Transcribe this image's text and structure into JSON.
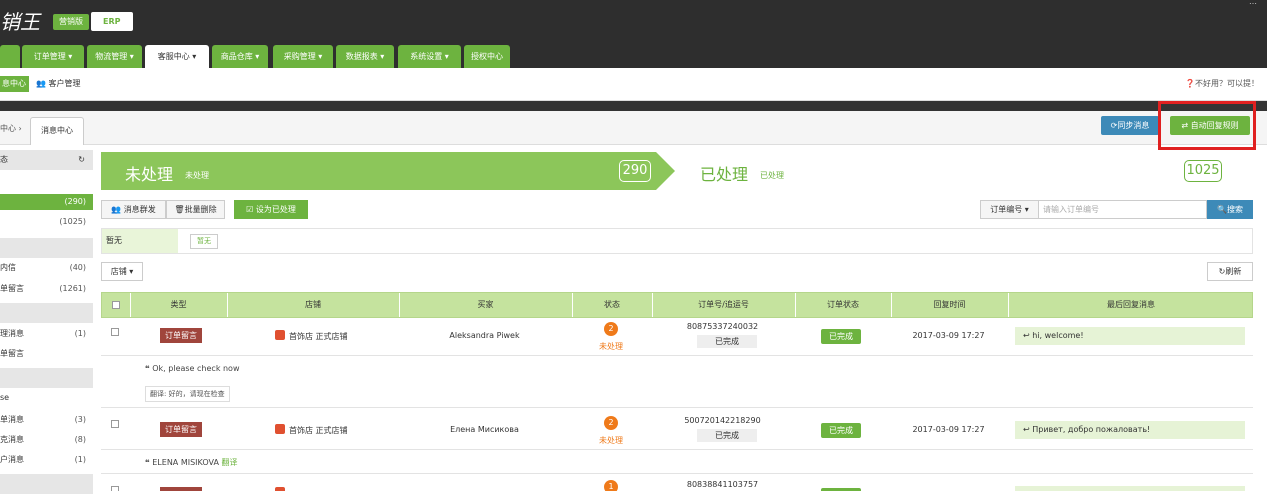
{
  "header": {
    "logo": "销王",
    "edition": "营销版",
    "erp": "ERP",
    "top_right": "…"
  },
  "nav": {
    "items": [
      "订单管理 ▾",
      "物流管理 ▾",
      "客服中心 ▾",
      "商品仓库 ▾",
      "采购管理 ▾",
      "数据报表 ▾",
      "系统设置 ▾",
      "授权中心"
    ]
  },
  "subnav": {
    "msg_center": "息中心",
    "customer_mgmt": "客户管理",
    "help": "不好用？可以提！"
  },
  "breadcrumb": {
    "parent": "中心 ›",
    "current": "消息中心"
  },
  "actions": {
    "sync": "同步消息",
    "auto_reply": "自动回复规则"
  },
  "sidebar": {
    "sections": [
      {
        "title": "态"
      },
      {
        "title": ""
      },
      {
        "title": ""
      },
      {
        "title": ""
      },
      {
        "title": ""
      }
    ],
    "rows": [
      {
        "label": "",
        "count": "(290)"
      },
      {
        "label": "",
        "count": "(1025)"
      },
      {
        "label": "内信",
        "count": "(40)"
      },
      {
        "label": "单留言",
        "count": "(1261)"
      },
      {
        "label": "理消息",
        "count": "(1)"
      },
      {
        "label": "单留言",
        "count": ""
      },
      {
        "label": "se",
        "count": ""
      },
      {
        "label": "单消息",
        "count": "(3)"
      },
      {
        "label": "克消息",
        "count": "(8)"
      },
      {
        "label": "户消息",
        "count": "(1)"
      }
    ]
  },
  "status_panels": {
    "unprocessed_title": "未处理",
    "unprocessed_sub": "未处理",
    "unprocessed_count": "290",
    "processed_title": "已处理",
    "processed_sub": "已处理",
    "processed_count": "1025"
  },
  "toolbar": {
    "broadcast": "消息群发",
    "batch_delete": "批量删除",
    "mark_processed": "设为已处理",
    "filter_select": "订单编号 ▾",
    "filter_placeholder": "请输入订单编号",
    "search": "搜索"
  },
  "tags": {
    "label": "暂无",
    "pill": "暂无"
  },
  "shop_select": "店铺 ▾",
  "refresh": "刷新",
  "table": {
    "headers": [
      "类型",
      "店铺",
      "买家",
      "状态",
      "订单号/追运号",
      "订单状态",
      "回复时间",
      "最后回复消息"
    ],
    "rows": [
      {
        "type": "订单留言",
        "shop": "首饰店 正式店铺",
        "buyer": "Aleksandra Piwek",
        "status_num": "2",
        "status_text": "未处理",
        "order_no": "80875337240032",
        "order_box": "已完成",
        "order_status": "已完成",
        "reply_time": "2017-03-09 17:27",
        "last_msg": "hi, welcome!",
        "quote": "Ok, please check now",
        "translation": "翻译: 好的，请现在检查"
      },
      {
        "type": "订单留言",
        "shop": "首饰店 正式店铺",
        "buyer": "Елена Мисикова",
        "status_num": "2",
        "status_text": "未处理",
        "order_no": "500720142218290",
        "order_box": "已完成",
        "order_status": "已完成",
        "reply_time": "2017-03-09 17:27",
        "last_msg": "Привет, добро пожаловать!",
        "quote": "ELENA MISIKOVA",
        "translation": "翻译"
      },
      {
        "status_num": "1",
        "order_no": "80838841103757"
      }
    ]
  },
  "colors": {
    "green": "#6db33f",
    "blue": "#3d8ab8",
    "orange": "#ef7a1a",
    "brown": "#a0453c",
    "red_highlight": "#e02020"
  }
}
